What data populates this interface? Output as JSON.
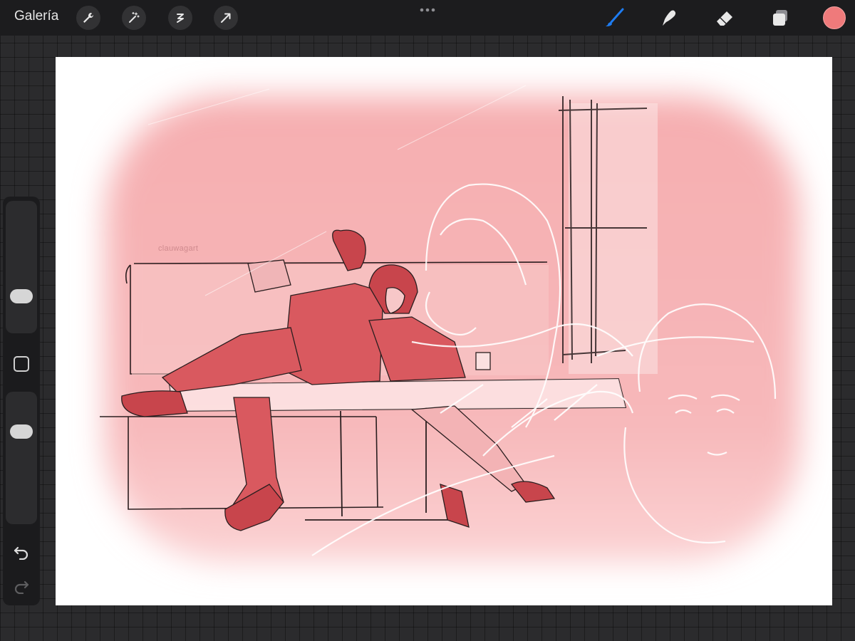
{
  "toolbar": {
    "gallery_label": "Galería",
    "left_tools": [
      "wrench-icon",
      "magic-wand-icon",
      "selection-icon",
      "transform-arrow-icon"
    ],
    "right_tools": [
      "brush-icon",
      "smudge-icon",
      "eraser-icon",
      "layers-icon"
    ],
    "active_tool": "brush",
    "accent_color": "#1e7cf2",
    "current_color": "#ef7a7b"
  },
  "sidebar": {
    "items": [
      "brush-size-slider",
      "modify-button",
      "opacity-slider",
      "undo-icon",
      "redo-icon"
    ]
  },
  "canvas": {
    "watermark": "clauwagart",
    "palette": {
      "pink": "#f4a8ab",
      "red": "#d9595f",
      "sketch": "#2a1e1f"
    }
  }
}
